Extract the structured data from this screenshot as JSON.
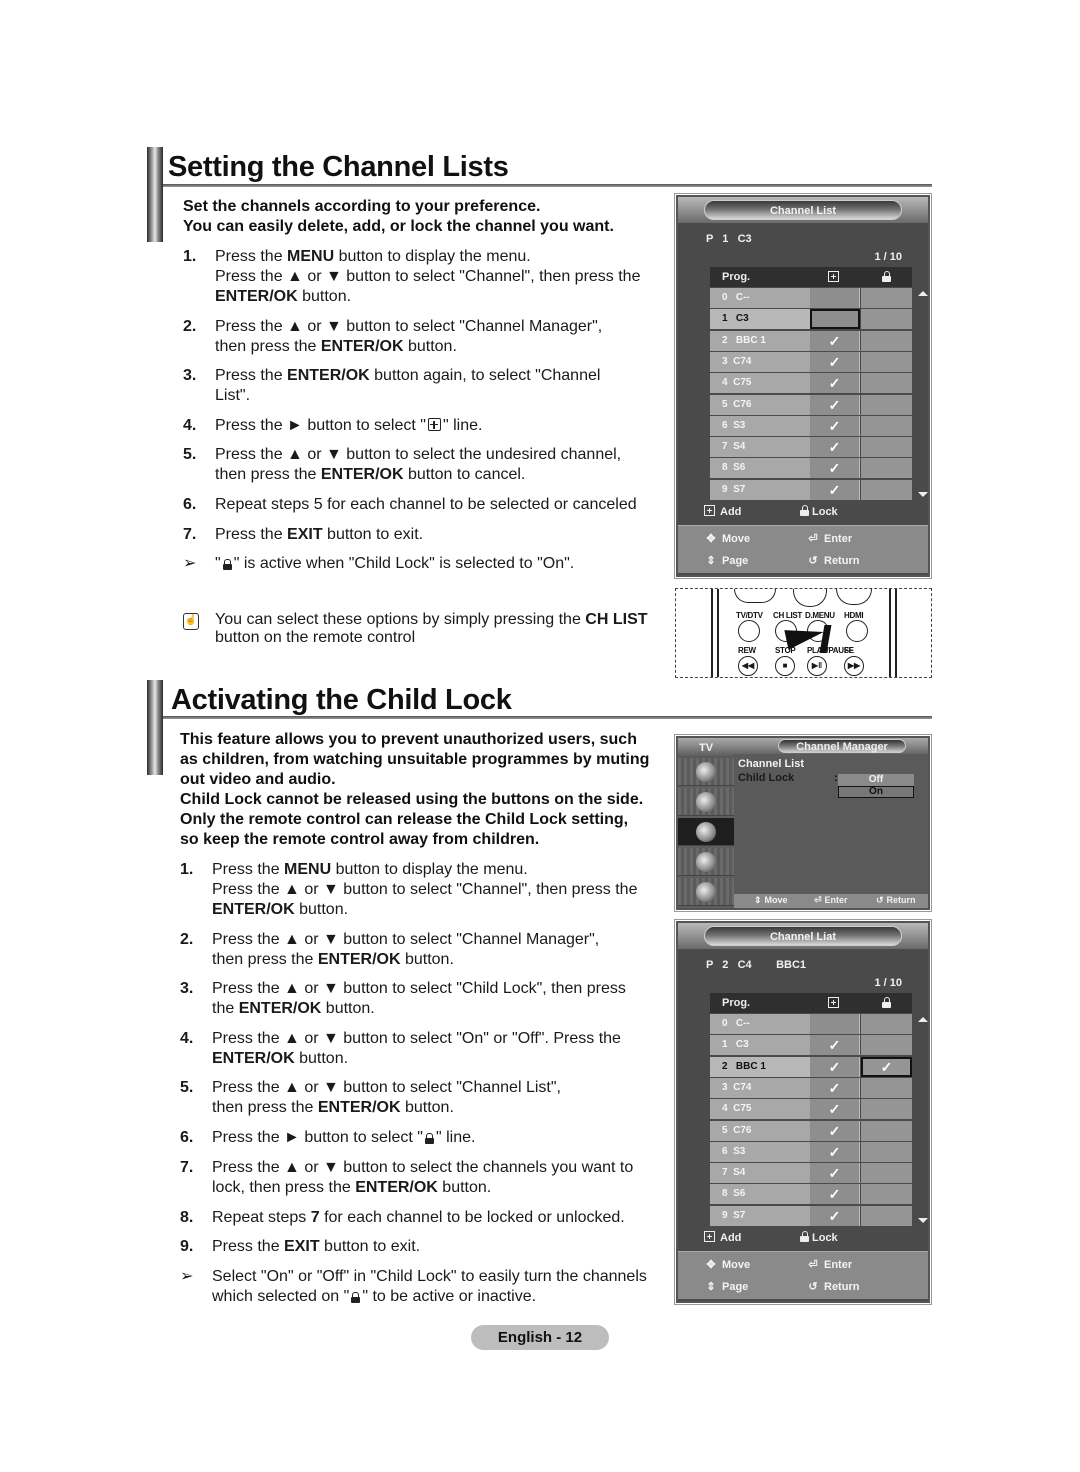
{
  "page": {
    "label": "English - 12"
  },
  "section1": {
    "title": "Setting the Channel Lists",
    "intro": [
      "Set the channels according to your preference.",
      "You can easily delete, add, or lock the channel you want."
    ],
    "steps": [
      {
        "num": "1.",
        "lines": [
          [
            "Press the ",
            {
              "b": "MENU"
            },
            " button to display the menu."
          ],
          [
            "Press the ▲ or ▼ button to select \"Channel\", then press the"
          ],
          [
            {
              "b": "ENTER/OK"
            },
            " button."
          ]
        ]
      },
      {
        "num": "2.",
        "lines": [
          [
            "Press the ▲ or ▼ button to select \"Channel Manager\","
          ],
          [
            "then press the ",
            {
              "b": "ENTER/OK"
            },
            " button."
          ]
        ]
      },
      {
        "num": "3.",
        "lines": [
          [
            "Press the ",
            {
              "b": "ENTER/OK"
            },
            " button again, to select \"Channel"
          ],
          [
            "List\"."
          ]
        ]
      },
      {
        "num": "4.",
        "lines": [
          [
            "Press the ► button to select \"",
            {
              "icon": "add"
            },
            "\" line."
          ]
        ]
      },
      {
        "num": "5.",
        "lines": [
          [
            "Press the ▲ or ▼ button to select the undesired channel,"
          ],
          [
            "then press the ",
            {
              "b": "ENTER/OK"
            },
            " button to cancel."
          ]
        ]
      },
      {
        "num": "6.",
        "lines": [
          [
            "Repeat steps 5 for each channel to be selected or canceled"
          ]
        ]
      },
      {
        "num": "7.",
        "lines": [
          [
            "Press the ",
            {
              "b": "EXIT"
            },
            " button to exit."
          ]
        ]
      }
    ],
    "note": [
      "\"",
      {
        "icon": "lock"
      },
      "\" is active when \"Child Lock\" is selected to \"On\"."
    ],
    "tip": [
      [
        "You can select these options by simply pressing the ",
        {
          "b": "CH LIST"
        }
      ],
      [
        "button on the remote control"
      ]
    ]
  },
  "section2": {
    "title": "Activating the Child Lock",
    "intro": [
      "This feature allows you to prevent unauthorized users, such",
      "as children, from watching unsuitable programmes by muting",
      "out video and audio.",
      "Child Lock cannot be released using the buttons on the side.",
      "Only the remote control can release the Child Lock setting,",
      "so keep the remote control away from children."
    ],
    "steps": [
      {
        "num": "1.",
        "lines": [
          [
            "Press the ",
            {
              "b": "MENU"
            },
            " button to display the menu."
          ],
          [
            "Press the ▲ or ▼ button to select \"Channel\", then press the"
          ],
          [
            {
              "b": "ENTER/OK"
            },
            " button."
          ]
        ]
      },
      {
        "num": "2.",
        "lines": [
          [
            "Press the ▲ or ▼ button to select \"Channel Manager\","
          ],
          [
            "then press the ",
            {
              "b": "ENTER/OK"
            },
            " button."
          ]
        ]
      },
      {
        "num": "3.",
        "lines": [
          [
            "Press the ▲ or ▼ button to select \"Child Lock\", then press"
          ],
          [
            "the ",
            {
              "b": "ENTER/OK"
            },
            " button."
          ]
        ]
      },
      {
        "num": "4.",
        "lines": [
          [
            "Press the ▲ or ▼ button to select \"On\" or \"Off\". Press the"
          ],
          [
            {
              "b": "ENTER/OK"
            },
            " button."
          ]
        ]
      },
      {
        "num": "5.",
        "lines": [
          [
            "Press the ▲ or ▼ button to select \"Channel List\","
          ],
          [
            "then press the ",
            {
              "b": "ENTER/OK"
            },
            " button."
          ]
        ]
      },
      {
        "num": "6.",
        "lines": [
          [
            "Press the ► button to select \"",
            {
              "icon": "lock"
            },
            "\" line."
          ]
        ]
      },
      {
        "num": "7.",
        "lines": [
          [
            "Press the ▲ or ▼ button to select the channels you want to"
          ],
          [
            "lock, then press the ",
            {
              "b": "ENTER/OK"
            },
            " button."
          ]
        ]
      },
      {
        "num": "8.",
        "lines": [
          [
            "Repeat steps ",
            {
              "b": "7"
            },
            " for each channel to be locked or unlocked."
          ]
        ]
      },
      {
        "num": "9.",
        "lines": [
          [
            "Press the ",
            {
              "b": "EXIT"
            },
            " button to exit."
          ]
        ]
      }
    ],
    "note": [
      [
        "Select \"On\" or \"Off\" in \"Child Lock\" to easily turn the channels"
      ],
      [
        "which selected on \"",
        {
          "icon": "lock"
        },
        "\" to be active or inactive."
      ]
    ]
  },
  "osd1": {
    "title": "Channel List",
    "current": "P   1   C3",
    "page": "1 / 10",
    "header": {
      "prog": "Prog.",
      "add_icon": "add-icon",
      "lock_icon": "lock-icon"
    },
    "rows": [
      {
        "name": "0   C--",
        "add": "",
        "lock": "",
        "selected": false,
        "focus": ""
      },
      {
        "name": "1   C3",
        "add": "",
        "lock": "",
        "selected": true,
        "focus": "add"
      },
      {
        "name": "2   BBC 1",
        "add": "✓",
        "lock": "",
        "selected": false,
        "focus": ""
      },
      {
        "name": "3  C74",
        "add": "✓",
        "lock": "",
        "selected": false,
        "focus": ""
      },
      {
        "name": "4  C75",
        "add": "✓",
        "lock": "",
        "selected": false,
        "focus": ""
      },
      {
        "name": "5  C76",
        "add": "✓",
        "lock": "",
        "selected": false,
        "focus": ""
      },
      {
        "name": "6  S3",
        "add": "✓",
        "lock": "",
        "selected": false,
        "focus": ""
      },
      {
        "name": "7  S4",
        "add": "✓",
        "lock": "",
        "selected": false,
        "focus": ""
      },
      {
        "name": "8  S6",
        "add": "✓",
        "lock": "",
        "selected": false,
        "focus": ""
      },
      {
        "name": "9  S7",
        "add": "✓",
        "lock": "",
        "selected": false,
        "focus": ""
      }
    ],
    "legend": {
      "add": "Add",
      "lock": "Lock"
    },
    "hints": {
      "move": "Move",
      "enter": "Enter",
      "page": "Page",
      "return": "Return"
    }
  },
  "remote": {
    "labels": [
      "TV/DTV",
      "CH LIST",
      "D.MENU",
      "HDMI"
    ],
    "media_labels": [
      "REW",
      "STOP",
      "PLAY/PAUSE",
      "FF"
    ],
    "media_glyphs": [
      "◀◀",
      "■",
      "▶‖",
      "▶▶"
    ]
  },
  "osd_cm": {
    "side_label": "TV",
    "title": "Channel Manager",
    "items": [
      "Channel List",
      "Child Lock"
    ],
    "colon": ":",
    "options": [
      "Off",
      "On"
    ],
    "selected_option": "On",
    "hints": {
      "move": "Move",
      "enter": "Enter",
      "return": "Return"
    }
  },
  "osd2": {
    "title": "Channel Liat",
    "current": "P   2   C4        BBC1",
    "page": "1 / 10",
    "header": {
      "prog": "Prog.",
      "add_icon": "add-icon",
      "lock_icon": "lock-icon"
    },
    "rows": [
      {
        "name": "0   C--",
        "add": "",
        "lock": "",
        "selected": false,
        "focus": ""
      },
      {
        "name": "1   C3",
        "add": "✓",
        "lock": "",
        "selected": false,
        "focus": ""
      },
      {
        "name": "2   BBC 1",
        "add": "✓",
        "lock": "✓",
        "selected": true,
        "focus": "lock"
      },
      {
        "name": "3  C74",
        "add": "✓",
        "lock": "",
        "selected": false,
        "focus": ""
      },
      {
        "name": "4  C75",
        "add": "✓",
        "lock": "",
        "selected": false,
        "focus": ""
      },
      {
        "name": "5  C76",
        "add": "✓",
        "lock": "",
        "selected": false,
        "focus": ""
      },
      {
        "name": "6  S3",
        "add": "✓",
        "lock": "",
        "selected": false,
        "focus": ""
      },
      {
        "name": "7  S4",
        "add": "✓",
        "lock": "",
        "selected": false,
        "focus": ""
      },
      {
        "name": "8  S6",
        "add": "✓",
        "lock": "",
        "selected": false,
        "focus": ""
      },
      {
        "name": "9  S7",
        "add": "✓",
        "lock": "",
        "selected": false,
        "focus": ""
      }
    ],
    "legend": {
      "add": "Add",
      "lock": "Lock"
    },
    "hints": {
      "move": "Move",
      "enter": "Enter",
      "page": "Page",
      "return": "Return"
    }
  }
}
